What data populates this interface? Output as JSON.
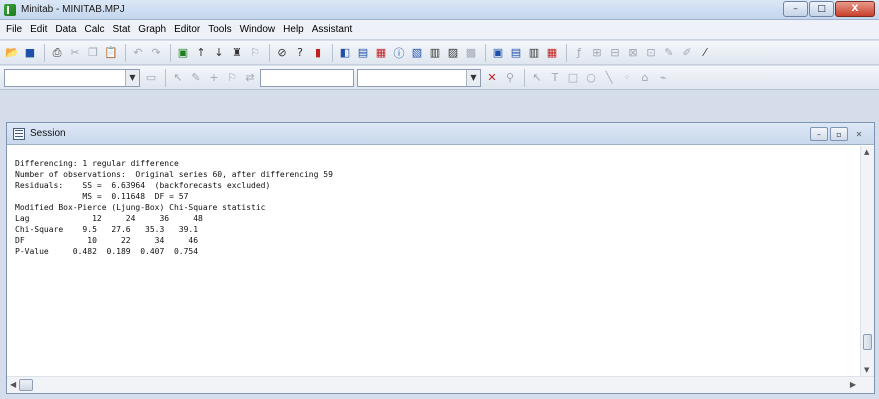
{
  "window": {
    "title": "Minitab - MINITAB.MPJ",
    "min": "–",
    "max": "□",
    "close": "X"
  },
  "menu": [
    "File",
    "Edit",
    "Data",
    "Calc",
    "Stat",
    "Graph",
    "Editor",
    "Tools",
    "Window",
    "Help",
    "Assistant"
  ],
  "session": {
    "title": "Session",
    "lines": [
      "Differencing: 1 regular difference",
      "Number of observations:  Original series 60, after differencing 59",
      "Residuals:    SS =  6.63964  (backforecasts excluded)",
      "              MS =  0.11648  DF = 57",
      "",
      "",
      "",
      "Modified Box-Pierce (Ljung-Box) Chi-Square statistic",
      "",
      "",
      "Lag             12     24     36     48",
      "Chi-Square    9.5   27.6   35.3   39.1",
      "DF             10     22     34     46",
      "P-Value     0.482  0.189  0.407  0.754"
    ]
  }
}
